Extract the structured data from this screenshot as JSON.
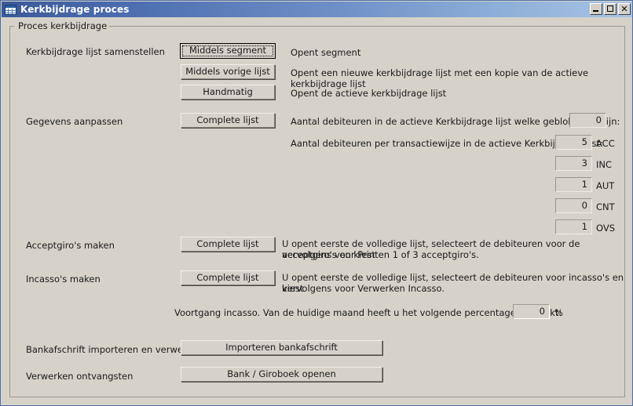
{
  "window": {
    "title": "Kerkbijdrage proces",
    "icon": "table-grid-icon",
    "buttons": {
      "minimize": "minimize-icon",
      "maximize": "maximize-icon",
      "close": "✕"
    }
  },
  "groupbox": {
    "legend": "Proces kerkbijdrage"
  },
  "sections": {
    "samenstellen": {
      "label": "Kerkbijdrage lijst samenstellen",
      "buttons": [
        {
          "label": "Middels  segment",
          "desc": "Opent segment"
        },
        {
          "label": "Middels vorige lijst",
          "desc": "Opent een nieuwe kerkbijdrage lijst met een kopie van de actieve kerkbijdrage lijst"
        },
        {
          "label": "Handmatig",
          "desc": "Opent de actieve kerkbijdrage lijst"
        }
      ]
    },
    "gegevens": {
      "label": "Gegevens aanpassen",
      "button": "Complete lijst",
      "blocked_label": "Aantal debiteuren in de actieve Kerkbijdrage lijst welke geblokkeerd zijn:",
      "blocked_value": "0",
      "per_transaction_label": "Aantal debiteuren per transactiewijze in de actieve Kerkbijdrage lijst:",
      "transaction_rows": [
        {
          "value": "5",
          "code": "ACC"
        },
        {
          "value": "3",
          "code": "INC"
        },
        {
          "value": "1",
          "code": "AUT"
        },
        {
          "value": "0",
          "code": "CNT"
        },
        {
          "value": "1",
          "code": "OVS"
        }
      ]
    },
    "acceptgiro": {
      "label": "Acceptgiro's maken",
      "button": "Complete lijst",
      "desc_line1": "U opent eerste de volledige lijst, selecteert de debiteuren voor de acceptgiro's en kiest",
      "desc_line2": "vervolgens voor Printen 1 of 3 acceptgiro's."
    },
    "incasso": {
      "label": "Incasso's maken",
      "button": "Complete lijst",
      "desc_line1": "U opent eerste de volledige lijst, selecteert de debiteuren voor incasso's en kiest",
      "desc_line2": "vervolgens voor Verwerken Incasso."
    },
    "voortgang": {
      "label": "Voortgang incasso. Van de huidige maand heeft u het volgende percentage verwerkt:",
      "value": "0",
      "unit": "%"
    },
    "bankafschrift": {
      "label": "Bankafschrift importeren en verwe...",
      "button": "Importeren bankafschrift"
    },
    "ontvangsten": {
      "label": "Verwerken ontvangsten",
      "button": "Bank / Giroboek openen"
    }
  },
  "colors": {
    "window_bg": "#d6d2ca",
    "title_start": "#3b5998",
    "title_end": "#a8c4e4",
    "text": "#1a1a1a"
  }
}
